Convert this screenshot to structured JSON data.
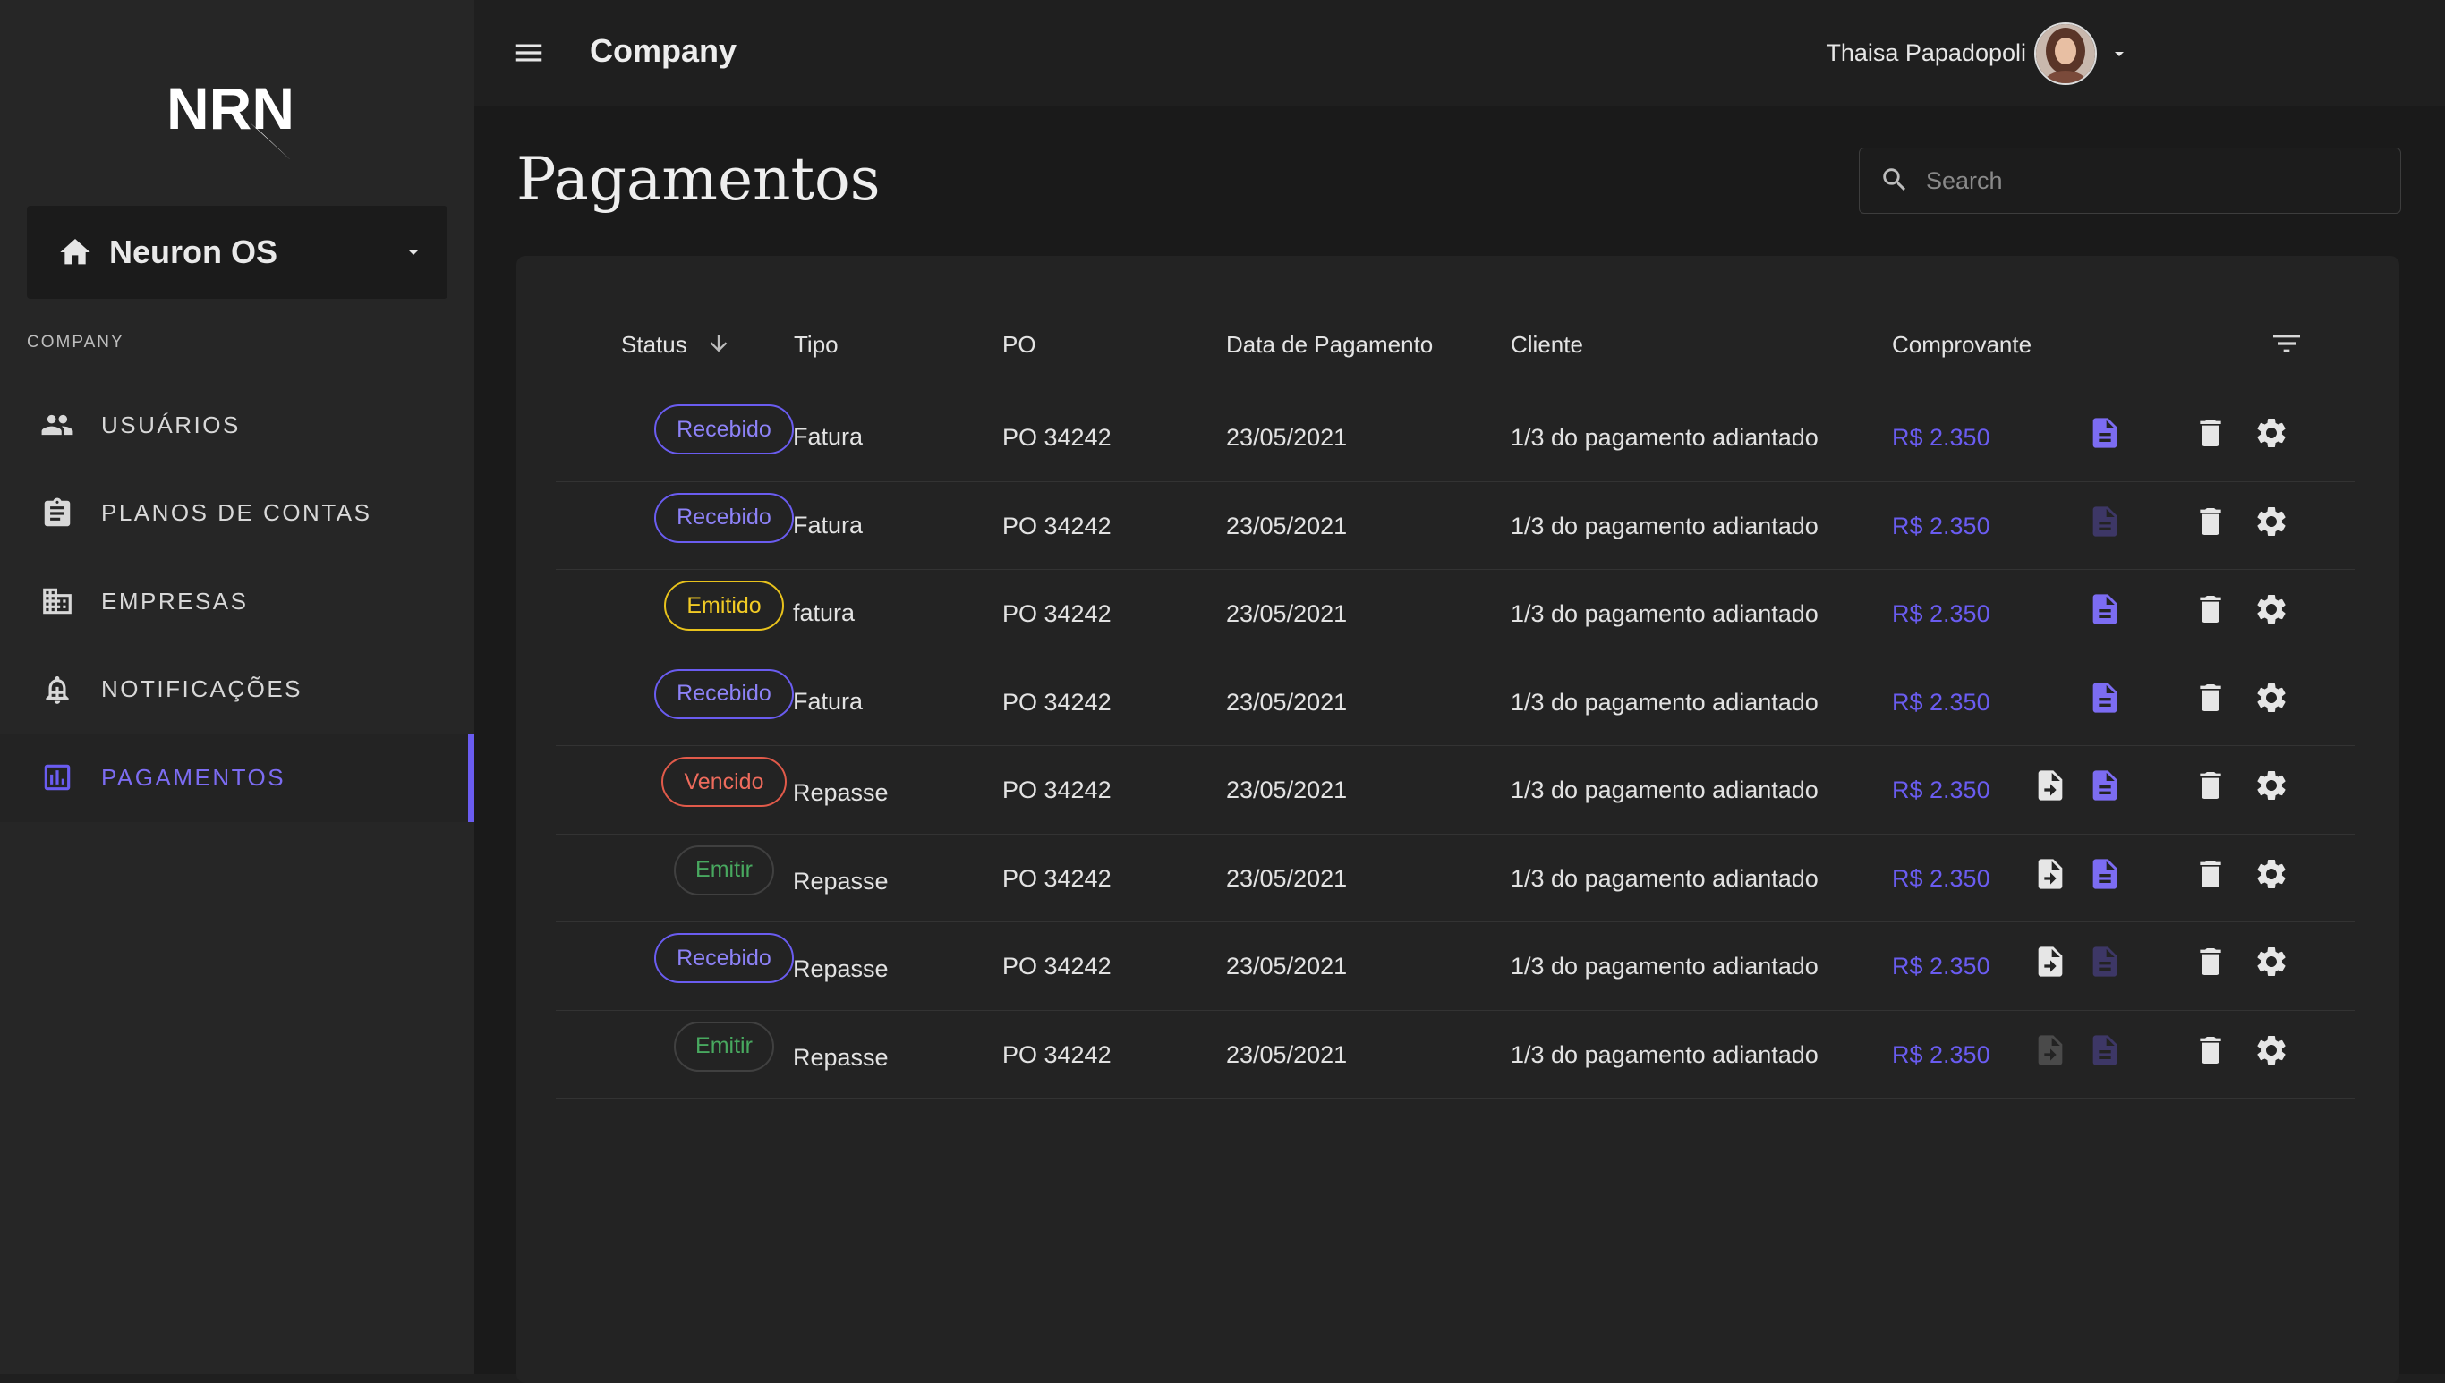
{
  "sidebar": {
    "logo_text": "NRN",
    "org_name": "Neuron OS",
    "section_label": "COMPANY",
    "items": [
      {
        "label": "USUÁRIOS",
        "icon": "users-icon"
      },
      {
        "label": "PLANOS DE CONTAS",
        "icon": "clipboard-icon"
      },
      {
        "label": "EMPRESAS",
        "icon": "building-icon"
      },
      {
        "label": "NOTIFICAÇÕES",
        "icon": "bell-icon"
      },
      {
        "label": "PAGAMENTOS",
        "icon": "bar-chart-icon",
        "active": true
      }
    ]
  },
  "topbar": {
    "title": "Company",
    "user_name": "Thaisa Papadopoli"
  },
  "page": {
    "title": "Pagamentos",
    "search_placeholder": "Search"
  },
  "table": {
    "headers": {
      "status": "Status",
      "tipo": "Tipo",
      "po": "PO",
      "data": "Data de Pagamento",
      "cliente": "Cliente",
      "comprovante": "Comprovante"
    },
    "rows": [
      {
        "status": "Recebido",
        "status_type": "recebido",
        "tipo": "Fatura",
        "po": "PO 34242",
        "data": "23/05/2021",
        "cliente": "1/3 do pagamento adiantado",
        "valor": "R$ 2.350",
        "upload": "none",
        "doc": "active"
      },
      {
        "status": "Recebido",
        "status_type": "recebido",
        "tipo": "Fatura",
        "po": "PO 34242",
        "data": "23/05/2021",
        "cliente": "1/3 do pagamento adiantado",
        "valor": "R$ 2.350",
        "upload": "none",
        "doc": "disabled"
      },
      {
        "status": "Emitido",
        "status_type": "emitido",
        "tipo": "fatura",
        "po": "PO 34242",
        "data": "23/05/2021",
        "cliente": "1/3 do pagamento adiantado",
        "valor": "R$ 2.350",
        "upload": "none",
        "doc": "active"
      },
      {
        "status": "Recebido",
        "status_type": "recebido",
        "tipo": "Fatura",
        "po": "PO 34242",
        "data": "23/05/2021",
        "cliente": "1/3 do pagamento adiantado",
        "valor": "R$ 2.350",
        "upload": "none",
        "doc": "active"
      },
      {
        "status": "Vencido",
        "status_type": "vencido",
        "tipo": "Repasse",
        "po": "PO 34242",
        "data": "23/05/2021",
        "cliente": "1/3 do pagamento adiantado",
        "valor": "R$ 2.350",
        "upload": "active",
        "doc": "active"
      },
      {
        "status": "Emitir",
        "status_type": "emitir",
        "tipo": "Repasse",
        "po": "PO 34242",
        "data": "23/05/2021",
        "cliente": "1/3 do pagamento adiantado",
        "valor": "R$ 2.350",
        "upload": "active",
        "doc": "active"
      },
      {
        "status": "Recebido",
        "status_type": "recebido",
        "tipo": "Repasse",
        "po": "PO 34242",
        "data": "23/05/2021",
        "cliente": "1/3 do pagamento adiantado",
        "valor": "R$ 2.350",
        "upload": "active",
        "doc": "disabled"
      },
      {
        "status": "Emitir",
        "status_type": "emitir",
        "tipo": "Repasse",
        "po": "PO 34242",
        "data": "23/05/2021",
        "cliente": "1/3 do pagamento adiantado",
        "valor": "R$ 2.350",
        "upload": "disabled",
        "doc": "disabled"
      }
    ]
  },
  "colors": {
    "accent": "#6a5cf0",
    "emitido": "#e8c21c",
    "vencido": "#e15a4a",
    "emitir": "#48a85f"
  }
}
